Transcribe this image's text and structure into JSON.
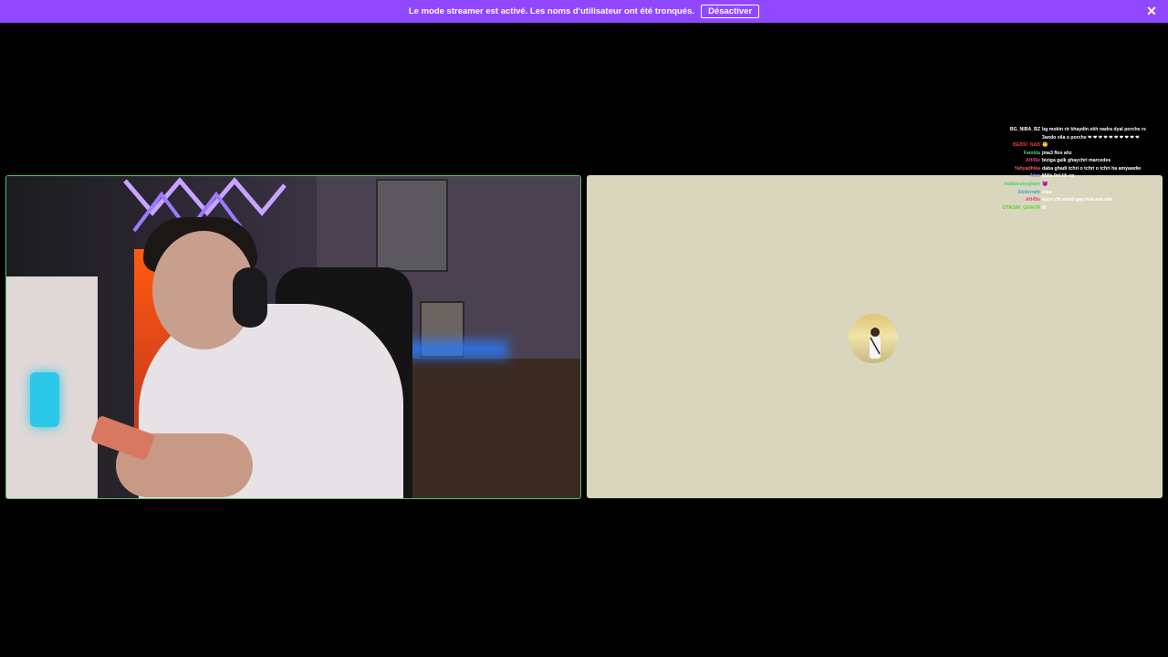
{
  "banner": {
    "message": "Le mode streamer est activé. Les noms d'utilisateur ont été tronqués.",
    "button_label": "Désactiver",
    "close_icon": "close-icon"
  },
  "colors": {
    "banner": "#9147ff",
    "cam_border": "#4cc46a",
    "screen_bg": "#d9d6bd"
  },
  "chat": {
    "messages": [
      {
        "user": "BG_NIBA_BZ",
        "user_color": "#ffffff",
        "text": "bg mokin rir khaydin ekh nadra dyal porche rs 3ando vila o porche ❤ ❤ ❤ ❤ ❤ ❤ ❤ ❤ ❤ ❤"
      },
      {
        "user": "BEBSI_NAB",
        "user_color": "#e23b3b",
        "text": "🙂"
      },
      {
        "user": "Famida",
        "user_color": "#4ed17a",
        "text": "jma3 flos ahz"
      },
      {
        "user": "AH45e",
        "user_color": "#e83f8a",
        "text": "biziga galk ghaychri marcedes"
      },
      {
        "user": "Yahyadhika",
        "user_color": "#f05a5a",
        "text": "daba ghadi tchri o tchri o tchri ha amyawdw"
      },
      {
        "user": "Ahm",
        "user_color": "#9e86e6",
        "text": "Milla 9ol lik oo"
      },
      {
        "user": "mahboubzgham",
        "user_color": "#3bcf7a",
        "text": "😈"
      },
      {
        "user": "Abderrahi",
        "user_color": "#36a7d6",
        "text": "olaa"
      },
      {
        "user": "AH45e",
        "user_color": "#e83f8a",
        "text": "kayn chi wahd gay hna ana ehe"
      },
      {
        "user": "OTAGRI_GHAYM",
        "user_color": "#56d33b",
        "text": "l9"
      }
    ]
  }
}
